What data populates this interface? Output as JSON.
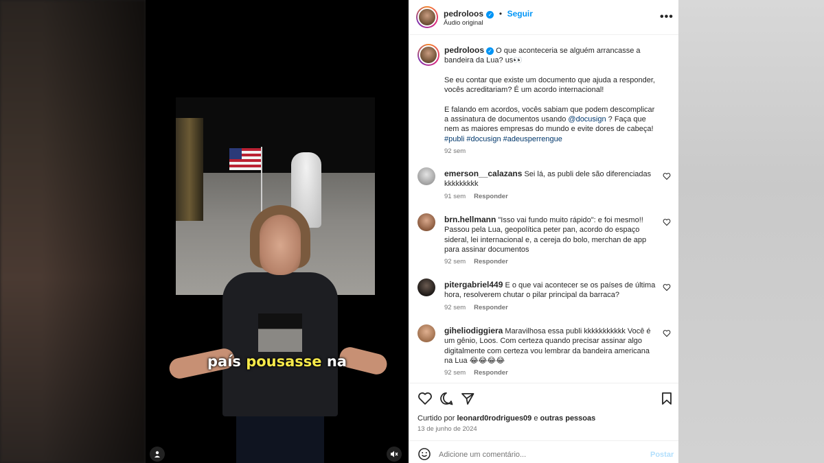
{
  "video": {
    "caption_before": "país ",
    "caption_highlight": "pousasse",
    "caption_after": " na",
    "user_icon": "person-icon",
    "mute_icon": "speaker-muted-icon"
  },
  "header": {
    "username": "pedroloos",
    "separator": "•",
    "follow_label": "Seguir",
    "audio_label": "Áudio original",
    "more_icon": "more-horizontal-icon"
  },
  "post": {
    "username": "pedroloos",
    "caption_line1": "O que aconteceria se alguém arrancasse a bandeira da Lua? us👀",
    "caption_p2": "Se eu contar que existe um documento que ajuda a responder, vocês acreditariam? É um acordo internacional!",
    "caption_p3_before": "E falando em acordos, vocês sabiam que podem descomplicar a assinatura de documentos usando ",
    "caption_mention": "@docusign",
    "caption_p3_after": " ? Faça que nem as maiores empresas do mundo e evite dores de cabeça!",
    "hashtags": "#publi #docusign #adeusperrengue",
    "time": "92 sem"
  },
  "comments": [
    {
      "username": "emerson__calazans",
      "text": "Sei lá, as publi dele são diferenciadas kkkkkkkkk",
      "time": "91 sem",
      "reply": "Responder"
    },
    {
      "username": "brn.hellmann",
      "text": "\"Isso vai fundo muito rápido\": e foi mesmo!! Passou pela Lua, geopolítica peter pan, acordo do espaço sideral, lei internacional e, a cereja do bolo, merchan de app para assinar documentos",
      "time": "92 sem",
      "reply": "Responder"
    },
    {
      "username": "pitergabriel449",
      "text": "E o que vai acontecer se os países de última hora, resolverem chutar o pilar principal da barraca?",
      "time": "92 sem",
      "reply": "Responder"
    },
    {
      "username": "gihеliodiggiera",
      "text": "Maravilhosa essa publi kkkkkkkkkkk Você é um gênio, Loos. Com certeza quando precisar assinar algo digitalmente com certeza vou lembrar da bandeira americana na Lua 😂😂😂😂",
      "time": "92 sem",
      "reply": "Responder"
    }
  ],
  "actions": {
    "liked_by_prefix": "Curtido por ",
    "liked_by_user": "leonard0rodrigues09",
    "liked_by_suffix": " e ",
    "liked_by_others": "outras pessoas",
    "date": "13 de junho de 2024",
    "icons": [
      "heart-icon",
      "comment-icon",
      "share-icon",
      "bookmark-icon"
    ]
  },
  "add_comment": {
    "placeholder": "Adicione um comentário...",
    "post_label": "Postar",
    "emoji_icon": "emoji-icon"
  },
  "colors": {
    "accent_blue": "#0095f6",
    "link": "#00376b",
    "muted": "#737373",
    "caption_highlight": "#f6e94a"
  }
}
